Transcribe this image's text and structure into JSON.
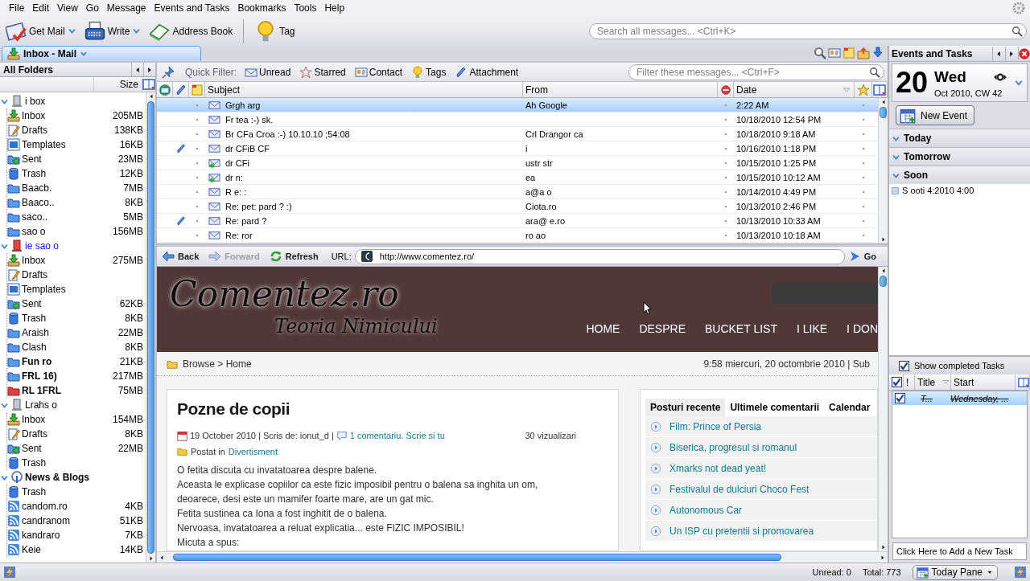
{
  "menu": [
    "File",
    "Edit",
    "View",
    "Go",
    "Message",
    "Events and Tasks",
    "Bookmarks",
    "Tools",
    "Help"
  ],
  "toolbar": {
    "buttons": [
      {
        "label": "Get Mail",
        "dropdown": true
      },
      {
        "label": "Write",
        "dropdown": true
      },
      {
        "label": "Address Book",
        "dropdown": false
      },
      {
        "label": "Tag",
        "dropdown": false
      }
    ],
    "search": {
      "placeholder": "Search all messages... <Ctrl+K>"
    }
  },
  "tab": {
    "label": "Inbox - Mail"
  },
  "folder_pane": {
    "title": "All Folders",
    "size_header": "Size",
    "accounts": [
      {
        "name": "i box",
        "kind": "server",
        "expanded": true,
        "unread": false,
        "new_mail": false,
        "children": [
          {
            "name": "Inbox",
            "size": "205MB",
            "kind": "inbox",
            "unread": false
          },
          {
            "name": "Drafts",
            "size": "138KB",
            "kind": "drafts",
            "unread": false
          },
          {
            "name": "Templates",
            "size": "16KB",
            "kind": "templates",
            "unread": false
          },
          {
            "name": "Sent",
            "size": "23MB",
            "kind": "sent",
            "unread": false
          },
          {
            "name": "Trash",
            "size": "12KB",
            "kind": "trash",
            "unread": false
          },
          {
            "name": "Baacb.",
            "size": "7MB",
            "kind": "folder",
            "unread": false
          },
          {
            "name": "Baaco..",
            "size": "8KB",
            "kind": "folder",
            "unread": false
          },
          {
            "name": "saco..",
            "size": "5MB",
            "kind": "folder",
            "unread": false
          },
          {
            "name": "sao o",
            "size": "156MB",
            "kind": "folder",
            "unread": false
          }
        ]
      },
      {
        "name": "ie sao o",
        "kind": "serverred",
        "expanded": true,
        "unread": false,
        "new_mail": true,
        "children": [
          {
            "name": "Inbox",
            "size": "275MB",
            "kind": "inbox",
            "unread": false
          },
          {
            "name": "Drafts",
            "kind": "drafts",
            "unread": false
          },
          {
            "name": "Templates",
            "kind": "templates",
            "unread": false
          },
          {
            "name": "Sent",
            "size": "62KB",
            "kind": "sent",
            "unread": false
          },
          {
            "name": "Trash",
            "size": "8KB",
            "kind": "trash",
            "unread": false
          },
          {
            "name": "Araish",
            "size": "22MB",
            "kind": "folder",
            "unread": false
          },
          {
            "name": "Clash",
            "size": "8KB",
            "kind": "folder",
            "unread": false
          },
          {
            "name": "Fun ro",
            "size": "21KB",
            "kind": "folder",
            "unread": true
          },
          {
            "name": "FRL 16)",
            "size": "217MB",
            "kind": "folder",
            "unread": true
          },
          {
            "name": "RL 1FRL",
            "size": "75MB",
            "kind": "folderred",
            "unread": true
          }
        ]
      },
      {
        "name": "Lrahs o",
        "kind": "server",
        "expanded": true,
        "unread": false,
        "new_mail": false,
        "children": [
          {
            "name": "Inbox",
            "size": "154MB",
            "kind": "inbox",
            "unread": false
          },
          {
            "name": "Drafts",
            "size": "8KB",
            "kind": "drafts",
            "unread": false
          },
          {
            "name": "Sent",
            "size": "22MB",
            "kind": "sent",
            "unread": false
          },
          {
            "name": "Trash",
            "kind": "trash",
            "unread": false
          }
        ]
      },
      {
        "name": "News & Blogs",
        "kind": "antenna",
        "expanded": true,
        "unread": true,
        "new_mail": false,
        "children": [
          {
            "name": "Trash",
            "kind": "trash",
            "unread": false
          },
          {
            "name": "candom.ro",
            "size": "4KB",
            "kind": "rss",
            "unread": false
          },
          {
            "name": "candranom",
            "size": "51KB",
            "kind": "rss",
            "unread": false
          },
          {
            "name": "kandraro",
            "size": "7KB",
            "kind": "rss",
            "unread": false
          },
          {
            "name": "Keie",
            "size": "14KB",
            "kind": "rss",
            "unread": false
          }
        ]
      }
    ]
  },
  "quick_filter": {
    "label": "Quick Filter:",
    "buttons": [
      "Unread",
      "Starred",
      "Contact",
      "Tags",
      "Attachment"
    ],
    "search": {
      "placeholder": "Filter these messages... <Ctrl+F>"
    }
  },
  "message_list": {
    "columns": {
      "subject": "Subject",
      "from": "From",
      "date": "Date"
    },
    "messages": [
      {
        "subject": "Grgh arg",
        "from": "Ah Google",
        "date": "2:22 AM",
        "attachment": false,
        "replied": false,
        "selected": true
      },
      {
        "subject": "Fr tea :-) sk.",
        "date": "10/18/2010 12:54 PM",
        "attachment": false,
        "replied": false,
        "selected": false
      },
      {
        "subject": "Br CFa Croa :-) 10.10.10 ;54:08",
        "from": "Crl Drangor ca",
        "date": "10/18/2010 9:18 AM",
        "attachment": false,
        "replied": false,
        "selected": false
      },
      {
        "subject": "dr CFiB CF",
        "from": "i",
        "date": "10/16/2010 1:18 PM",
        "attachment": true,
        "replied": false,
        "selected": false
      },
      {
        "subject": "dr CFi",
        "from": "ustr str",
        "date": "10/15/2010 1:25 PM",
        "attachment": false,
        "replied": true,
        "selected": false
      },
      {
        "subject": "dr n:",
        "from": "ea",
        "date": "10/15/2010 10:12 AM",
        "attachment": false,
        "replied": true,
        "selected": false
      },
      {
        "subject": "R e: :",
        "from": "a@a o",
        "date": "10/14/2010 4:49 PM",
        "attachment": false,
        "replied": false,
        "selected": false
      },
      {
        "subject": "Re: pet: pard ? :)",
        "from": "Ciota.ro",
        "date": "10/13/2010 2:46 PM",
        "attachment": false,
        "replied": false,
        "selected": false
      },
      {
        "subject": "Re: pard ?",
        "from": "ara@ e.ro",
        "date": "10/13/2010 10:33 AM",
        "attachment": true,
        "replied": false,
        "selected": false
      },
      {
        "subject": "Re: ror",
        "from": "ro ao",
        "date": "10/13/2010 10:18 AM",
        "attachment": false,
        "replied": false,
        "selected": false
      }
    ]
  },
  "browser": {
    "buttons": [
      {
        "label": "Back",
        "disabled": false
      },
      {
        "label": "Forward",
        "disabled": true
      },
      {
        "label": "Refresh",
        "disabled": false
      }
    ],
    "url_label": "URL:",
    "url": "http://www.comentez.ro/",
    "go": "Go"
  },
  "web_page": {
    "logo": "Comentez.ro",
    "tagline": "Teoria Nimicului",
    "nav": [
      "HOME",
      "DESPRE",
      "BUCKET LIST",
      "I LIKE",
      "I DON"
    ],
    "breadcrumb": "Browse > Home",
    "date_line": "9:58 miercuri, 20 octombrie 2010 | Sub",
    "article": {
      "title": "Pozne de copii",
      "meta": "19 October 2010 | Scris de: ionut_d |",
      "comments_link": "1 comentariu. Scrie si tu",
      "views": "30 vizualizari",
      "category_label": "Postat in",
      "category": "Divertisment",
      "lines": [
        "O fetita discuta cu invatatoarea despre balene.",
        "Aceasta le explicase copiilor ca este fizic imposibil pentru o balena sa inghita un om,",
        "deoarece, desi este un mamifer foarte mare, are un gat mic.",
        "Fetita sustinea ca Iona a fost inghitit de o balena.",
        "Nervoasa, invatatoarea a reluat explicatia... este FIZIC IMPOSIBIL!",
        "Micuta a spus:"
      ]
    },
    "sidebar": {
      "tabs": [
        {
          "label": "Posturi recente",
          "selected": true
        },
        {
          "label": "Ultimele comentarii",
          "selected": false
        },
        {
          "label": "Calendar",
          "selected": false
        }
      ],
      "posts": [
        "Film: Prince of Persia",
        "Biserica, progresul si romanul",
        "Xmarks not dead yeat!",
        "Festivalul de dulciuri Choco Fest",
        "Autonomous Car",
        "Un ISP cu pretentii si promovarea"
      ]
    }
  },
  "today_pane": {
    "title": "Events and Tasks",
    "day": "20",
    "weekday": "Wed",
    "month_line": "Oct 2010, CW 42",
    "new_event": "New Event",
    "sections": [
      {
        "label": "Today",
        "expanded": true
      },
      {
        "label": "Tomorrow",
        "expanded": true
      },
      {
        "label": "Soon",
        "expanded": true,
        "items": [
          "S ooti 4:2010 4:00"
        ]
      }
    ],
    "tasks": {
      "show_completed": {
        "label": "Show completed Tasks",
        "checked": true
      },
      "columns": {
        "priority": "!",
        "title": "Title",
        "start": "Start"
      },
      "all_checked": true,
      "items": [
        {
          "title": "T...",
          "start": "Wednesday, ...",
          "completed": true,
          "selected": true
        }
      ],
      "add_placeholder": "Click Here to Add a New Task"
    }
  },
  "status_bar": {
    "unread": "Unread: 0",
    "total": "Total: 773",
    "today_pane": "Today Pane"
  }
}
